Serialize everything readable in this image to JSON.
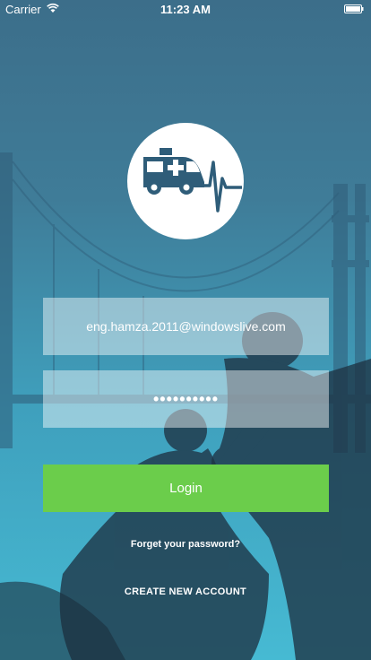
{
  "status_bar": {
    "carrier": "Carrier",
    "time": "11:23 AM",
    "wifi_icon": "wifi-icon",
    "battery_icon": "battery-icon"
  },
  "logo": {
    "icon": "ambulance-heartbeat-icon"
  },
  "login_form": {
    "email_value": "eng.hamza.2011@windowslive.com",
    "password_value": "••••••••••",
    "login_label": "Login",
    "forgot_label": "Forget your password?",
    "create_account_label": "CREATE NEW ACCOUNT"
  },
  "colors": {
    "login_button": "#6bcd4b",
    "field_background": "rgba(255,255,255,0.45)",
    "background_top": "#3c6e8a",
    "background_bottom": "#46bad3"
  }
}
